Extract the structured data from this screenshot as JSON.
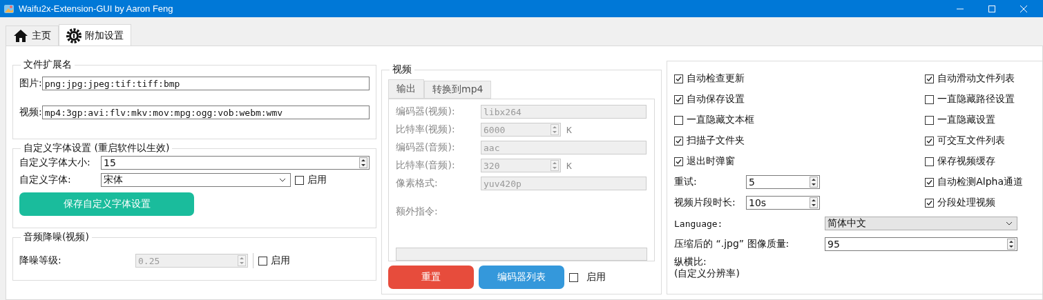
{
  "window": {
    "title": "Waifu2x-Extension-GUI by Aaron Feng"
  },
  "tabs": [
    {
      "label": "主页",
      "kind": "home",
      "selected": false
    },
    {
      "label": "附加设置",
      "kind": "gear",
      "selected": true
    }
  ],
  "file_extensions": {
    "title": "文件扩展名",
    "fields": [
      {
        "label": "图片:",
        "value": "png:jpg:jpeg:tif:tiff:bmp"
      },
      {
        "label": "视频:",
        "value": "mp4:3gp:avi:flv:mkv:mov:mpg:ogg:vob:webm:wmv"
      }
    ]
  },
  "custom_font": {
    "title": "自定义字体设置 (重启软件以生效)",
    "size_label": "自定义字体大小:",
    "size_value": "15",
    "font_label": "自定义字体:",
    "font_value": "宋体",
    "enable": {
      "label": "启用",
      "checked": false
    },
    "save_button": "保存自定义字体设置"
  },
  "audio_denoise": {
    "title": "音频降噪(视频)",
    "level_label": "降噪等级:",
    "level_value": "0.25",
    "disabled": true,
    "enable": {
      "label": "启用",
      "checked": false
    }
  },
  "video": {
    "title": "视频",
    "tabs": [
      {
        "label": "输出",
        "selected": true
      },
      {
        "label": "转换到mp4",
        "selected": false
      }
    ],
    "fields": [
      {
        "kind": "text",
        "label": "编码器(视频):",
        "value": "libx264",
        "disabled": true
      },
      {
        "kind": "spin",
        "label": "比特率(视频):",
        "value": "6000",
        "unit": "K",
        "disabled": true
      },
      {
        "kind": "text",
        "label": "编码器(音频):",
        "value": "aac",
        "disabled": true
      },
      {
        "kind": "spin",
        "label": "比特率(音频):",
        "value": "320",
        "unit": "K",
        "disabled": true
      },
      {
        "kind": "text",
        "label": "像素格式:",
        "value": "yuv420p",
        "disabled": true
      }
    ],
    "extra_label": "额外指令:",
    "extra_disabled": true,
    "reset_button": "重置",
    "encoders_button": "编码器列表",
    "enable": {
      "label": "启用",
      "checked": false
    }
  },
  "settings": {
    "left": [
      {
        "kind": "check",
        "label": "自动检查更新",
        "checked": true
      },
      {
        "kind": "check",
        "label": "自动保存设置",
        "checked": true
      },
      {
        "kind": "check",
        "label": "一直隐藏文本框",
        "checked": false
      },
      {
        "kind": "check",
        "label": "扫描子文件夹",
        "checked": true
      },
      {
        "kind": "check",
        "label": "退出时弹窗",
        "checked": true
      },
      {
        "kind": "spin",
        "label": "重试:",
        "value": "5"
      },
      {
        "kind": "spin",
        "label": "视频片段时长:",
        "value": "10s"
      }
    ],
    "right": [
      {
        "kind": "check",
        "label": "自动滑动文件列表",
        "checked": true
      },
      {
        "kind": "check",
        "label": "一直隐藏路径设置",
        "checked": false
      },
      {
        "kind": "check",
        "label": "一直隐藏设置",
        "checked": false
      },
      {
        "kind": "check",
        "label": "可交互文件列表",
        "checked": true
      },
      {
        "kind": "check",
        "label": "保存视频缓存",
        "checked": false
      },
      {
        "kind": "check",
        "label": "自动检测Alpha通道",
        "checked": true
      },
      {
        "kind": "check",
        "label": "分段处理视频",
        "checked": true
      }
    ],
    "language_label": "Language:",
    "language_value": "简体中文",
    "quality_label": "压缩后的 “.jpg” 图像质量:",
    "quality_value": "95",
    "aspect_label": [
      "纵横比:",
      "(自定义分辨率)"
    ]
  }
}
